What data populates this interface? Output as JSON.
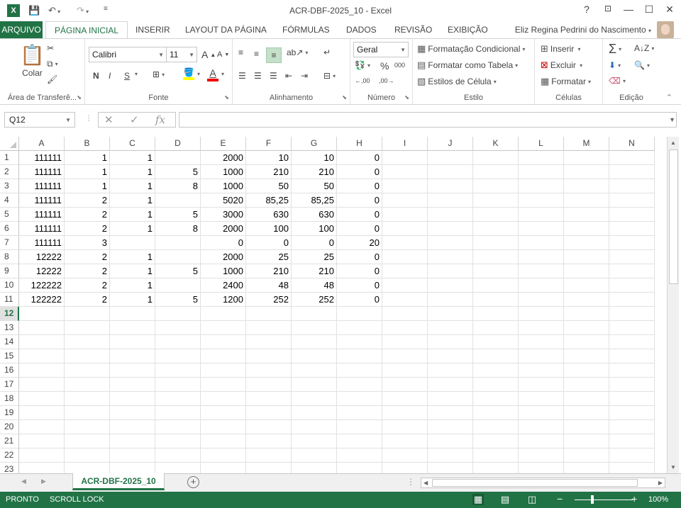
{
  "app": {
    "title": "ACR-DBF-2025_10 - Excel",
    "logo": "X",
    "accent": "#217346"
  },
  "quick_access": {
    "save_icon": "save-icon",
    "undo_icon": "undo-icon",
    "redo_icon": "redo-icon"
  },
  "window_controls": {
    "help": "?",
    "restore_ribbon": "⊡",
    "minimize": "—",
    "maximize": "☐",
    "close": "✕"
  },
  "tabs": {
    "file": "ARQUIVO",
    "items": [
      "PÁGINA INICIAL",
      "INSERIR",
      "LAYOUT DA PÁGINA",
      "FÓRMULAS",
      "DADOS",
      "REVISÃO",
      "EXIBIÇÃO"
    ],
    "active": "PÁGINA INICIAL"
  },
  "user": {
    "name": "Eliz Regina Pedrini do Nascimento"
  },
  "ribbon": {
    "clipboard": {
      "label": "Área de Transferê...",
      "paste": "Colar"
    },
    "font": {
      "label": "Fonte",
      "family": "Calibri",
      "size": "11",
      "bold": "N",
      "italic": "I",
      "underline": "S",
      "font_color_letter": "A"
    },
    "alignment": {
      "label": "Alinhamento"
    },
    "number": {
      "label": "Número",
      "format": "Geral",
      "percent": "%",
      "thousands": "000"
    },
    "styles": {
      "label": "Estilo",
      "conditional": "Formatação Condicional",
      "as_table": "Formatar como Tabela",
      "cell_styles": "Estilos de Célula"
    },
    "cells": {
      "label": "Células",
      "insert": "Inserir",
      "delete": "Excluir",
      "format": "Formatar"
    },
    "editing": {
      "label": "Edição"
    }
  },
  "formula_bar": {
    "name_box": "Q12",
    "fx": "fx",
    "value": ""
  },
  "sheet": {
    "columns": [
      "A",
      "B",
      "C",
      "D",
      "E",
      "F",
      "G",
      "H",
      "I",
      "J",
      "K",
      "L",
      "M",
      "N"
    ],
    "row_numbers": [
      "1",
      "2",
      "3",
      "4",
      "5",
      "6",
      "7",
      "8",
      "9",
      "10",
      "11",
      "12",
      "13",
      "14",
      "15",
      "16",
      "17",
      "18",
      "19",
      "20",
      "21",
      "22",
      "23"
    ],
    "active_row": "12",
    "rows": [
      [
        "111111",
        "1",
        "1",
        "",
        "2000",
        "10",
        "10",
        "0"
      ],
      [
        "111111",
        "1",
        "1",
        "5",
        "1000",
        "210",
        "210",
        "0"
      ],
      [
        "111111",
        "1",
        "1",
        "8",
        "1000",
        "50",
        "50",
        "0"
      ],
      [
        "111111",
        "2",
        "1",
        "",
        "5020",
        "85,25",
        "85,25",
        "0"
      ],
      [
        "111111",
        "2",
        "1",
        "5",
        "3000",
        "630",
        "630",
        "0"
      ],
      [
        "111111",
        "2",
        "1",
        "8",
        "2000",
        "100",
        "100",
        "0"
      ],
      [
        "111111",
        "3",
        "",
        "",
        "0",
        "0",
        "0",
        "20"
      ],
      [
        "12222",
        "2",
        "1",
        "",
        "2000",
        "25",
        "25",
        "0"
      ],
      [
        "12222",
        "2",
        "1",
        "5",
        "1000",
        "210",
        "210",
        "0"
      ],
      [
        "122222",
        "2",
        "1",
        "",
        "2400",
        "48",
        "48",
        "0"
      ],
      [
        "122222",
        "2",
        "1",
        "5",
        "1200",
        "252",
        "252",
        "0"
      ]
    ]
  },
  "sheet_tabs": {
    "active": "ACR-DBF-2025_10",
    "add": "+"
  },
  "status": {
    "ready": "PRONTO",
    "scroll_lock": "SCROLL LOCK",
    "zoom": "100%"
  }
}
